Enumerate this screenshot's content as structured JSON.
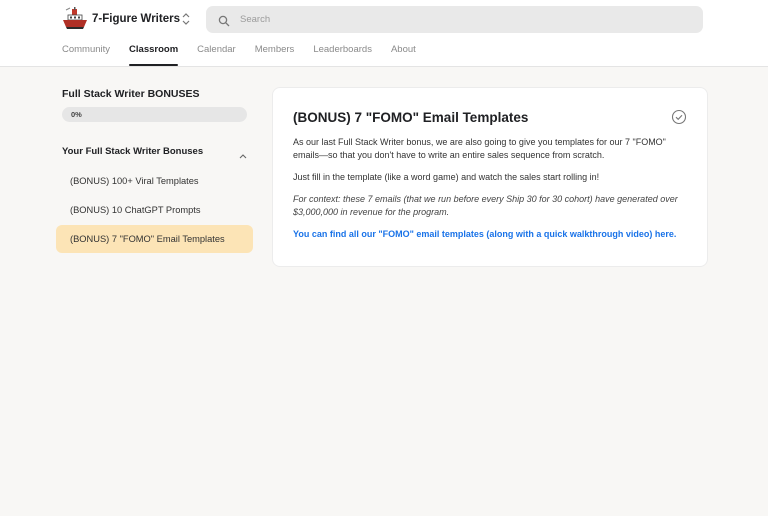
{
  "header": {
    "brand_name": "7-Figure Writers",
    "search_placeholder": "Search"
  },
  "nav": {
    "tabs": [
      {
        "label": "Community",
        "active": false
      },
      {
        "label": "Classroom",
        "active": true
      },
      {
        "label": "Calendar",
        "active": false
      },
      {
        "label": "Members",
        "active": false
      },
      {
        "label": "Leaderboards",
        "active": false
      },
      {
        "label": "About",
        "active": false
      }
    ]
  },
  "sidebar": {
    "course_title": "Full Stack Writer BONUSES",
    "progress_label": "0%",
    "progress": 0,
    "section_title": "Your Full Stack Writer Bonuses",
    "lessons": [
      {
        "label": "(BONUS) 100+ Viral Templates"
      },
      {
        "label": "(BONUS) 10 ChatGPT Prompts"
      },
      {
        "label": "(BONUS) 7 \"FOMO\" Email Templates"
      }
    ]
  },
  "content": {
    "title": "(BONUS) 7 \"FOMO\" Email Templates",
    "paragraph_1": "As our last Full Stack Writer bonus, we are also going to give you templates for our 7 \"FOMO\" emails—so that you don't have to write an entire sales sequence from scratch.",
    "paragraph_2": "Just fill in the template (like a word game) and watch the sales start rolling in!",
    "paragraph_3": "For context: these 7 emails (that we run before every Ship 30 for 30 cohort) have generated over $3,000,000 in revenue for the program.",
    "link_text": "You can find all our \"FOMO\" email templates (along with a quick walkthrough video) here."
  },
  "colors": {
    "accent_link": "#1a73e8",
    "active_lesson_bg": "#fce4b6",
    "logo_red": "#c0392b"
  }
}
